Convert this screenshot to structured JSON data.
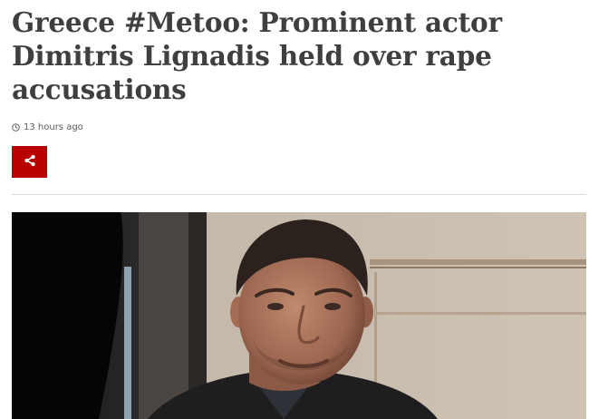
{
  "article": {
    "headline": "Greece #Metoo: Prominent actor Dimitris Lignadis held over rape accusations",
    "timestamp": "13 hours ago",
    "icons": {
      "timestamp": "clock-icon",
      "share": "share-icon"
    }
  },
  "colors": {
    "headline": "#3f3f42",
    "share_button": "#b80000",
    "divider": "#d9d9d9"
  }
}
